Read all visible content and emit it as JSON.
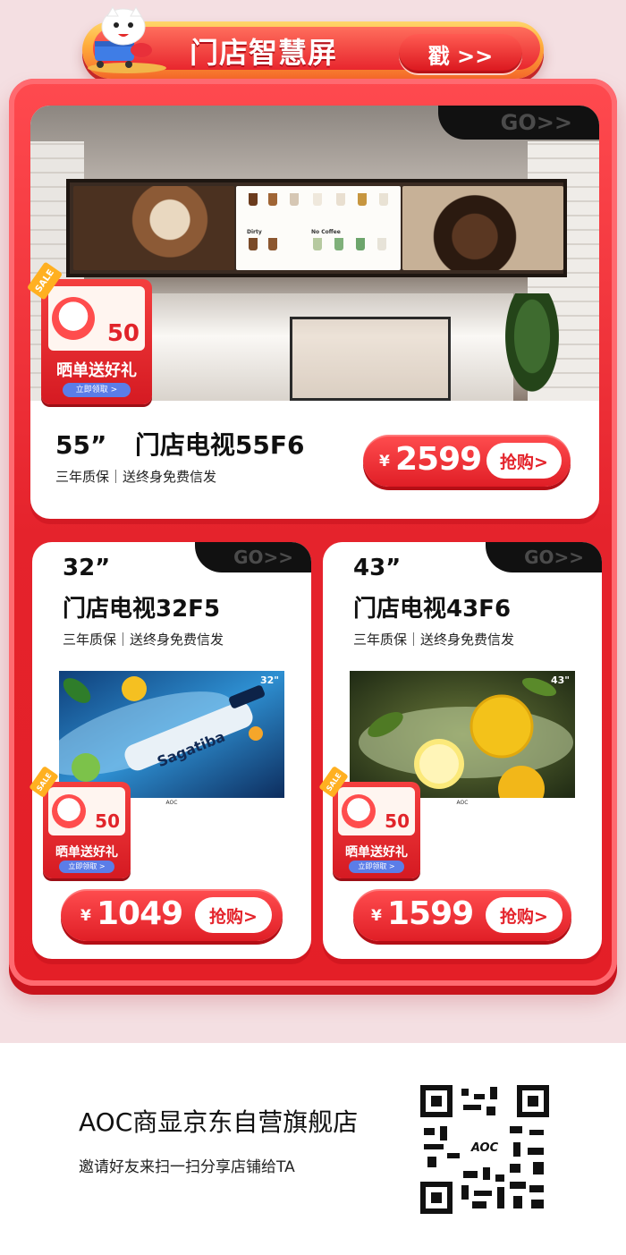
{
  "header": {
    "title": "门店智慧屏",
    "button_label": "戳 >>"
  },
  "colors": {
    "brand_red": "#e4232b",
    "gold": "#ffb021",
    "coupon_blue": "#5b7de8"
  },
  "go_label": "GO>>",
  "sale_badge": {
    "tag": "SALE",
    "amount": "50",
    "gift_text": "晒单送好礼",
    "claim_text": "立即领取 >"
  },
  "products": [
    {
      "size": "55”",
      "name": "门店电视55F6",
      "features": "三年质保｜送终身免费信发",
      "currency": "¥",
      "price": "2599",
      "buy_label": "抢购>"
    },
    {
      "size": "32”",
      "name": "门店电视32F5",
      "features": "三年质保｜送终身免费信发",
      "currency": "¥",
      "price": "1049",
      "buy_label": "抢购>",
      "screen_size_label": "32\"",
      "bottle_text": "Sagatiba",
      "tv_brand": "AOC"
    },
    {
      "size": "43”",
      "name": "门店电视43F6",
      "features": "三年质保｜送终身免费信发",
      "currency": "¥",
      "price": "1599",
      "buy_label": "抢购>",
      "screen_size_label": "43\"",
      "tv_brand": "AOC"
    }
  ],
  "menu_board": {
    "section_a": "Dirty",
    "section_b": "No Coffee"
  },
  "footer": {
    "store_name": "AOC商显京东自营旗舰店",
    "invite_text": "邀请好友来扫一扫分享店铺给TA",
    "qr_logo": "AOC"
  }
}
